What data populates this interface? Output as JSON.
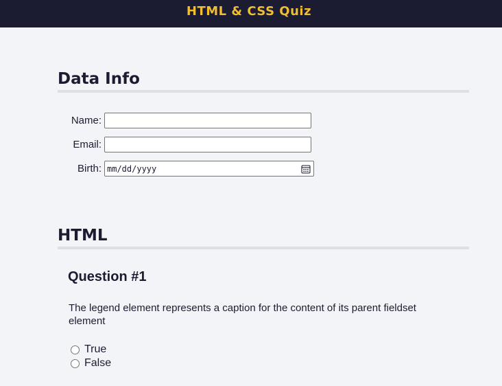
{
  "header": {
    "title": "HTML & CSS Quiz"
  },
  "data_info": {
    "heading": "Data Info",
    "fields": {
      "name_label": "Name:",
      "name_value": "",
      "email_label": "Email:",
      "email_value": "",
      "birth_label": "Birth:",
      "birth_placeholder": "mm/dd/yyyy"
    },
    "calendar_icon": "calendar-icon"
  },
  "html_section": {
    "heading": "HTML",
    "question": {
      "title": "Question #1",
      "text": "The legend element represents a caption for the content of its parent fieldset element",
      "options": [
        {
          "label": "True",
          "selected": false
        },
        {
          "label": "False",
          "selected": false
        }
      ]
    }
  },
  "colors": {
    "header_bg": "#1b1b32",
    "header_text": "#f1be32",
    "page_bg": "#f3f4f7",
    "heading_border": "#dfdfe2"
  }
}
